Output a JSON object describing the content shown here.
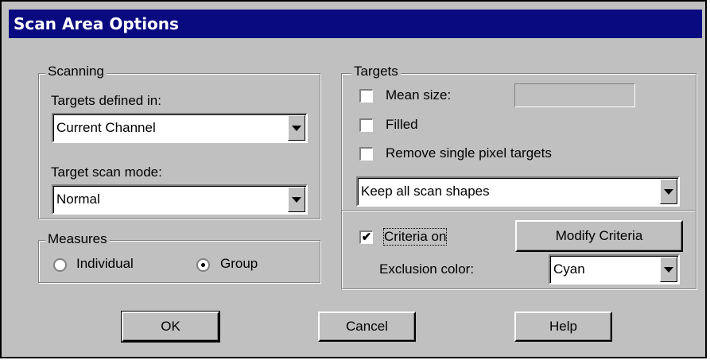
{
  "window": {
    "title": "Scan Area Options"
  },
  "scanning": {
    "group_label": "Scanning",
    "targets_defined_label": "Targets defined in:",
    "targets_defined_value": "Current Channel",
    "scan_mode_label": "Target scan mode:",
    "scan_mode_value": "Normal"
  },
  "measures": {
    "group_label": "Measures",
    "individual_label": "Individual",
    "group_option_label": "Group",
    "selected": "Group"
  },
  "targets": {
    "group_label": "Targets",
    "mean_size_label": "Mean size:",
    "mean_size_value": "",
    "filled_label": "Filled",
    "remove_single_label": "Remove single pixel targets",
    "shapes_value": "Keep all scan shapes",
    "criteria_on_label": "Criteria on",
    "criteria_on_checked": "✔",
    "modify_criteria_label": "Modify Criteria",
    "exclusion_color_label": "Exclusion color:",
    "exclusion_color_value": "Cyan"
  },
  "buttons": {
    "ok": "OK",
    "cancel": "Cancel",
    "help": "Help"
  },
  "colors": {
    "titlebar": "#0a0a80",
    "face": "#c0c0c0"
  }
}
